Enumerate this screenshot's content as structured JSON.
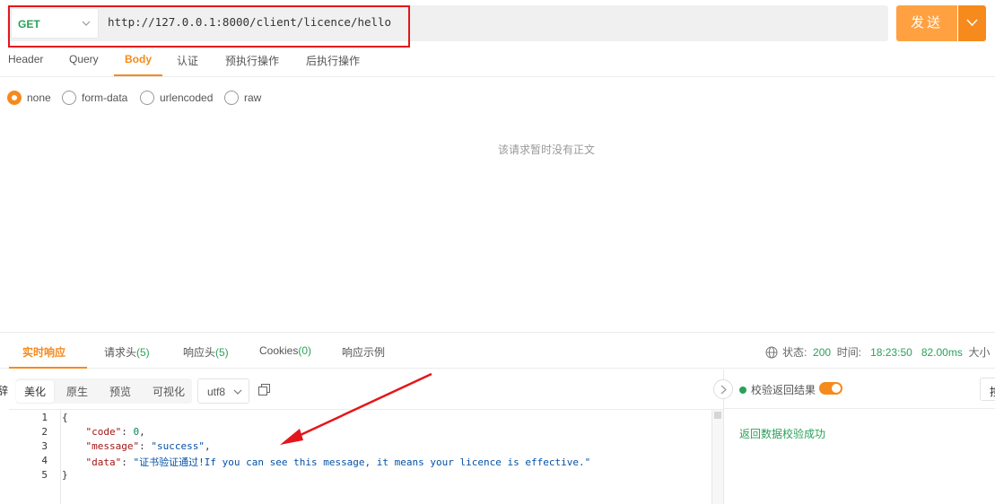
{
  "request": {
    "method": "GET",
    "url": "http://127.0.0.1:8000/client/licence/hello",
    "send_label": "发送"
  },
  "request_tabs": [
    {
      "label": "Header"
    },
    {
      "label": "Query"
    },
    {
      "label": "Body"
    },
    {
      "label": "认证"
    },
    {
      "label": "预执行操作"
    },
    {
      "label": "后执行操作"
    }
  ],
  "body_types": [
    {
      "label": "none",
      "checked": true
    },
    {
      "label": "form-data",
      "checked": false
    },
    {
      "label": "urlencoded",
      "checked": false
    },
    {
      "label": "raw",
      "checked": false
    }
  ],
  "body_empty_text": "该请求暂时没有正文",
  "response_tabs": {
    "realtime": "实时响应",
    "req_headers": "请求头",
    "req_headers_count": "(5)",
    "resp_headers": "响应头",
    "resp_headers_count": "(5)",
    "cookies": "Cookies",
    "cookies_count": "(0)",
    "example": "响应示例"
  },
  "status": {
    "status_label": "状态:",
    "status_value": "200",
    "time_label": "时间:",
    "time_value": "18:23:50",
    "duration": "82.00ms",
    "size_label": "大小"
  },
  "format_buttons": {
    "edge_char": "辞",
    "pretty": "美化",
    "raw": "原生",
    "preview": "预览",
    "visualize": "可视化"
  },
  "encoding": "utf8",
  "code_lines": {
    "l1": "{",
    "l2_key": "\"code\"",
    "l2_val": "0",
    "l3_key": "\"message\"",
    "l3_val": "\"success\"",
    "l4_key": "\"data\"",
    "l4_val": "\"证书验证通过!If you can see this message, it means your licence is effective.\"",
    "l5": "}"
  },
  "line_numbers": [
    "1",
    "2",
    "3",
    "4",
    "5"
  ],
  "validation": {
    "label": "校验返回结果",
    "enabled": true,
    "result": "返回数据校验成功",
    "edge_button": "按"
  },
  "colors": {
    "accent": "#f68a1c",
    "success": "#2aa15a",
    "annotation": "#e4161b"
  }
}
